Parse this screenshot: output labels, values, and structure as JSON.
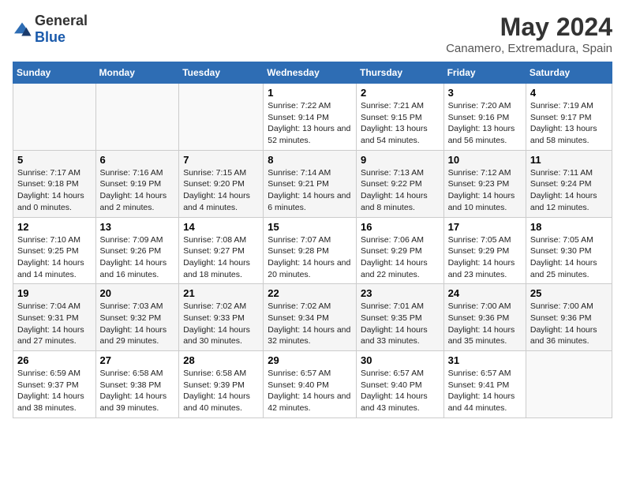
{
  "logo": {
    "general": "General",
    "blue": "Blue"
  },
  "title": "May 2024",
  "subtitle": "Canamero, Extremadura, Spain",
  "weekdays": [
    "Sunday",
    "Monday",
    "Tuesday",
    "Wednesday",
    "Thursday",
    "Friday",
    "Saturday"
  ],
  "weeks": [
    [
      {
        "day": "",
        "info": ""
      },
      {
        "day": "",
        "info": ""
      },
      {
        "day": "",
        "info": ""
      },
      {
        "day": "1",
        "info": "Sunrise: 7:22 AM\nSunset: 9:14 PM\nDaylight: 13 hours and 52 minutes."
      },
      {
        "day": "2",
        "info": "Sunrise: 7:21 AM\nSunset: 9:15 PM\nDaylight: 13 hours and 54 minutes."
      },
      {
        "day": "3",
        "info": "Sunrise: 7:20 AM\nSunset: 9:16 PM\nDaylight: 13 hours and 56 minutes."
      },
      {
        "day": "4",
        "info": "Sunrise: 7:19 AM\nSunset: 9:17 PM\nDaylight: 13 hours and 58 minutes."
      }
    ],
    [
      {
        "day": "5",
        "info": "Sunrise: 7:17 AM\nSunset: 9:18 PM\nDaylight: 14 hours and 0 minutes."
      },
      {
        "day": "6",
        "info": "Sunrise: 7:16 AM\nSunset: 9:19 PM\nDaylight: 14 hours and 2 minutes."
      },
      {
        "day": "7",
        "info": "Sunrise: 7:15 AM\nSunset: 9:20 PM\nDaylight: 14 hours and 4 minutes."
      },
      {
        "day": "8",
        "info": "Sunrise: 7:14 AM\nSunset: 9:21 PM\nDaylight: 14 hours and 6 minutes."
      },
      {
        "day": "9",
        "info": "Sunrise: 7:13 AM\nSunset: 9:22 PM\nDaylight: 14 hours and 8 minutes."
      },
      {
        "day": "10",
        "info": "Sunrise: 7:12 AM\nSunset: 9:23 PM\nDaylight: 14 hours and 10 minutes."
      },
      {
        "day": "11",
        "info": "Sunrise: 7:11 AM\nSunset: 9:24 PM\nDaylight: 14 hours and 12 minutes."
      }
    ],
    [
      {
        "day": "12",
        "info": "Sunrise: 7:10 AM\nSunset: 9:25 PM\nDaylight: 14 hours and 14 minutes."
      },
      {
        "day": "13",
        "info": "Sunrise: 7:09 AM\nSunset: 9:26 PM\nDaylight: 14 hours and 16 minutes."
      },
      {
        "day": "14",
        "info": "Sunrise: 7:08 AM\nSunset: 9:27 PM\nDaylight: 14 hours and 18 minutes."
      },
      {
        "day": "15",
        "info": "Sunrise: 7:07 AM\nSunset: 9:28 PM\nDaylight: 14 hours and 20 minutes."
      },
      {
        "day": "16",
        "info": "Sunrise: 7:06 AM\nSunset: 9:29 PM\nDaylight: 14 hours and 22 minutes."
      },
      {
        "day": "17",
        "info": "Sunrise: 7:05 AM\nSunset: 9:29 PM\nDaylight: 14 hours and 23 minutes."
      },
      {
        "day": "18",
        "info": "Sunrise: 7:05 AM\nSunset: 9:30 PM\nDaylight: 14 hours and 25 minutes."
      }
    ],
    [
      {
        "day": "19",
        "info": "Sunrise: 7:04 AM\nSunset: 9:31 PM\nDaylight: 14 hours and 27 minutes."
      },
      {
        "day": "20",
        "info": "Sunrise: 7:03 AM\nSunset: 9:32 PM\nDaylight: 14 hours and 29 minutes."
      },
      {
        "day": "21",
        "info": "Sunrise: 7:02 AM\nSunset: 9:33 PM\nDaylight: 14 hours and 30 minutes."
      },
      {
        "day": "22",
        "info": "Sunrise: 7:02 AM\nSunset: 9:34 PM\nDaylight: 14 hours and 32 minutes."
      },
      {
        "day": "23",
        "info": "Sunrise: 7:01 AM\nSunset: 9:35 PM\nDaylight: 14 hours and 33 minutes."
      },
      {
        "day": "24",
        "info": "Sunrise: 7:00 AM\nSunset: 9:36 PM\nDaylight: 14 hours and 35 minutes."
      },
      {
        "day": "25",
        "info": "Sunrise: 7:00 AM\nSunset: 9:36 PM\nDaylight: 14 hours and 36 minutes."
      }
    ],
    [
      {
        "day": "26",
        "info": "Sunrise: 6:59 AM\nSunset: 9:37 PM\nDaylight: 14 hours and 38 minutes."
      },
      {
        "day": "27",
        "info": "Sunrise: 6:58 AM\nSunset: 9:38 PM\nDaylight: 14 hours and 39 minutes."
      },
      {
        "day": "28",
        "info": "Sunrise: 6:58 AM\nSunset: 9:39 PM\nDaylight: 14 hours and 40 minutes."
      },
      {
        "day": "29",
        "info": "Sunrise: 6:57 AM\nSunset: 9:40 PM\nDaylight: 14 hours and 42 minutes."
      },
      {
        "day": "30",
        "info": "Sunrise: 6:57 AM\nSunset: 9:40 PM\nDaylight: 14 hours and 43 minutes."
      },
      {
        "day": "31",
        "info": "Sunrise: 6:57 AM\nSunset: 9:41 PM\nDaylight: 14 hours and 44 minutes."
      },
      {
        "day": "",
        "info": ""
      }
    ]
  ]
}
